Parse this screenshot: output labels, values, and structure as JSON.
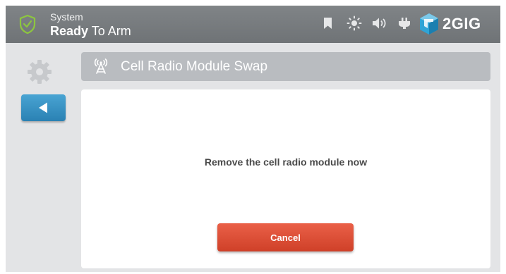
{
  "header": {
    "status_line1": "System",
    "status_emphasis": "Ready",
    "status_rest": " To Arm",
    "brand": "2GIG",
    "icons": [
      "shield-check-icon",
      "bookmark-icon",
      "brightness-icon",
      "volume-icon",
      "power-plug-icon",
      "2gig-logo-icon"
    ]
  },
  "sidebar": {
    "icons": [
      "gear-icon",
      "back-arrow-icon"
    ]
  },
  "title_bar": {
    "icon": "cell-tower-icon",
    "title": "Cell Radio Module Swap"
  },
  "panel": {
    "message": "Remove the cell radio module now",
    "cancel_label": "Cancel"
  },
  "colors": {
    "header_bg": "#74787b",
    "shield_green": "#8dc63f",
    "back_blue": "#3a93c6",
    "cancel_red": "#e0553b",
    "title_bar_bg": "#b9bcc0",
    "screen_bg": "#e3e4e6"
  }
}
